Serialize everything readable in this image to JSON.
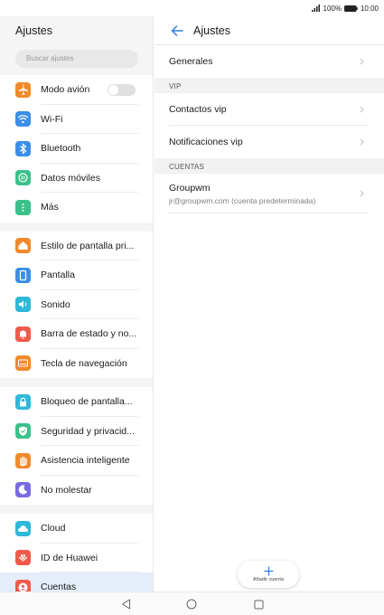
{
  "statusbar": {
    "battery": "100%",
    "time": "10:00"
  },
  "left": {
    "title": "Ajustes",
    "search_placeholder": "Buscar ajustes",
    "groups": [
      [
        {
          "label": "Modo avión",
          "icon": "airplane-icon",
          "color": "#f08a2c",
          "toggle": true
        },
        {
          "label": "Wi-Fi",
          "icon": "wifi-icon",
          "color": "#3c8ee6"
        },
        {
          "label": "Bluetooth",
          "icon": "bluetooth-icon",
          "color": "#3c8ee6"
        },
        {
          "label": "Datos móviles",
          "icon": "mobile-data-icon",
          "color": "#3cc08a"
        },
        {
          "label": "Más",
          "icon": "more-icon",
          "color": "#3cc08a"
        }
      ],
      [
        {
          "label": "Estilo de pantalla pri...",
          "icon": "home-icon",
          "color": "#f08a2c"
        },
        {
          "label": "Pantalla",
          "icon": "display-icon",
          "color": "#3c8ee6"
        },
        {
          "label": "Sonido",
          "icon": "sound-icon",
          "color": "#2fb8d8"
        },
        {
          "label": "Barra de estado y no...",
          "icon": "notification-icon",
          "color": "#f05a4a"
        },
        {
          "label": "Tecla de navegación",
          "icon": "nav-key-icon",
          "color": "#f08a2c"
        }
      ],
      [
        {
          "label": "Bloqueo de pantalla...",
          "icon": "lock-icon",
          "color": "#2fb8d8"
        },
        {
          "label": "Seguridad y privacid...",
          "icon": "shield-icon",
          "color": "#3cc08a"
        },
        {
          "label": "Asistencia inteligente",
          "icon": "hand-icon",
          "color": "#f08a2c"
        },
        {
          "label": "No molestar",
          "icon": "moon-icon",
          "color": "#7a6ae0"
        }
      ],
      [
        {
          "label": "Cloud",
          "icon": "cloud-icon",
          "color": "#2fb8d8"
        },
        {
          "label": "ID de Huawei",
          "icon": "huawei-icon",
          "color": "#f05a4a"
        },
        {
          "label": "Cuentas",
          "icon": "account-icon",
          "color": "#f05a4a",
          "selected": true
        }
      ]
    ]
  },
  "right": {
    "title": "Ajustes",
    "generales": "Generales",
    "vip_section": "VIP",
    "contactos_vip": "Contactos vip",
    "notificaciones_vip": "Notificaciones vip",
    "cuentas_section": "CUENTAS",
    "account_name": "Groupwm",
    "account_sub": "jr@groupwm.com (cuenta predeterminada)",
    "add_account": "Añadir cuenta"
  },
  "colors": {
    "accent": "#2f7fe0",
    "selected_bg": "#e4eefa"
  }
}
